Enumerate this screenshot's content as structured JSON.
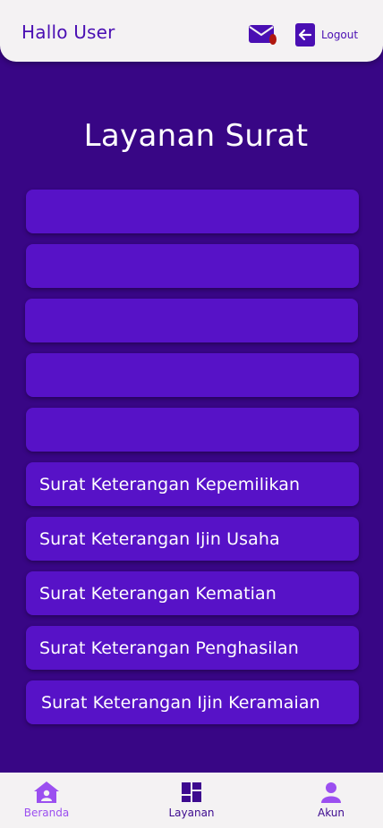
{
  "header": {
    "greeting": "Hallo User",
    "mail_icon": "mail-icon",
    "logout_icon": "logout-icon",
    "logout_label": "Logout"
  },
  "main": {
    "title": "Layanan Surat",
    "services": [
      {
        "label": ""
      },
      {
        "label": ""
      },
      {
        "label": ""
      },
      {
        "label": ""
      },
      {
        "label": ""
      },
      {
        "label": "Surat Keterangan Kepemilikan"
      },
      {
        "label": "Surat Keterangan Ijin Usaha"
      },
      {
        "label": "Surat Keterangan Kematian"
      },
      {
        "label": "Surat Keterangan Penghasilan"
      },
      {
        "label": "Surat Keterangan Ijin Keramaian"
      }
    ]
  },
  "bottom_nav": {
    "items": [
      {
        "label": "Beranda",
        "icon": "home-icon",
        "active": true
      },
      {
        "label": "Layanan",
        "icon": "grid-icon",
        "active": false
      },
      {
        "label": "Akun",
        "icon": "user-icon",
        "active": false
      }
    ]
  },
  "colors": {
    "background": "#380685",
    "card": "#5712c7",
    "accent": "#4a0fb3",
    "active_nav": "#9b4ff0",
    "notification_dot": "#b0180e"
  }
}
